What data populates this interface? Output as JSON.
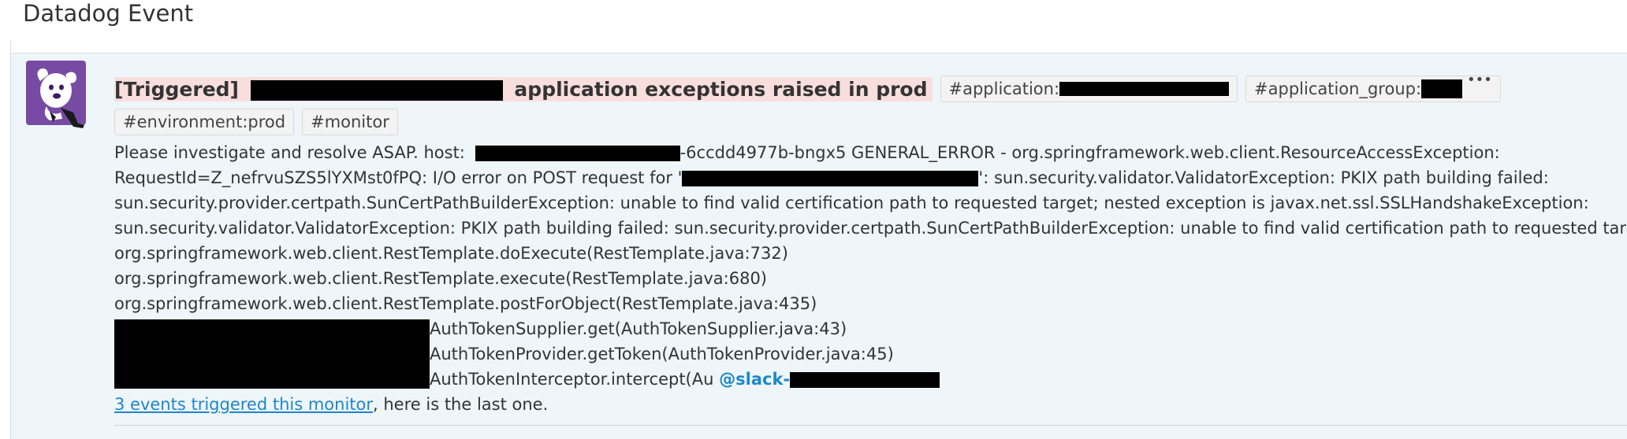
{
  "page": {
    "title": "Datadog Event"
  },
  "event": {
    "avatar_icon": "datadog-bits-dog-icon",
    "status": "[Triggered]",
    "title_suffix": "application exceptions raised in prod",
    "title_highlight_color": "#f9dede",
    "tags": [
      {
        "label": "#application:"
      },
      {
        "label": "#application_group:"
      },
      {
        "label": "#environment:prod"
      },
      {
        "label": "#monitor"
      }
    ],
    "tag_more_icon": "ellipsis-icon",
    "message": {
      "line1_prefix": "Please investigate and resolve ASAP. host:",
      "line1_suffix": "-6ccdd4977b-bngx5 GENERAL_ERROR - org.springframework.web.client.ResourceAccessException:",
      "line2_prefix": "RequestId=Z_nefrvuSZS5lYXMst0fPQ: I/O error on POST request for '",
      "line2_suffix": "': sun.security.validator.ValidatorException: PKIX path building failed:",
      "line3": "sun.security.provider.certpath.SunCertPathBuilderException: unable to find valid certification path to requested target; nested exception is javax.net.ssl.SSLHandshakeException:",
      "line4": "sun.security.validator.ValidatorException: PKIX path building failed: sun.security.provider.certpath.SunCertPathBuilderException: unable to find valid certification path to requested target",
      "stack": [
        "org.springframework.web.client.RestTemplate.doExecute(RestTemplate.java:732)",
        "org.springframework.web.client.RestTemplate.execute(RestTemplate.java:680)",
        "org.springframework.web.client.RestTemplate.postForObject(RestTemplate.java:435)"
      ],
      "stack_redacted": [
        "AuthTokenSupplier.get(AuthTokenSupplier.java:43)",
        "AuthTokenProvider.getToken(AuthTokenProvider.java:45)",
        "AuthTokenInterceptor.intercept(Au"
      ],
      "mention": "@slack-",
      "footer_link": "3 events triggered this monitor",
      "footer_suffix": ", here is the last one."
    }
  }
}
